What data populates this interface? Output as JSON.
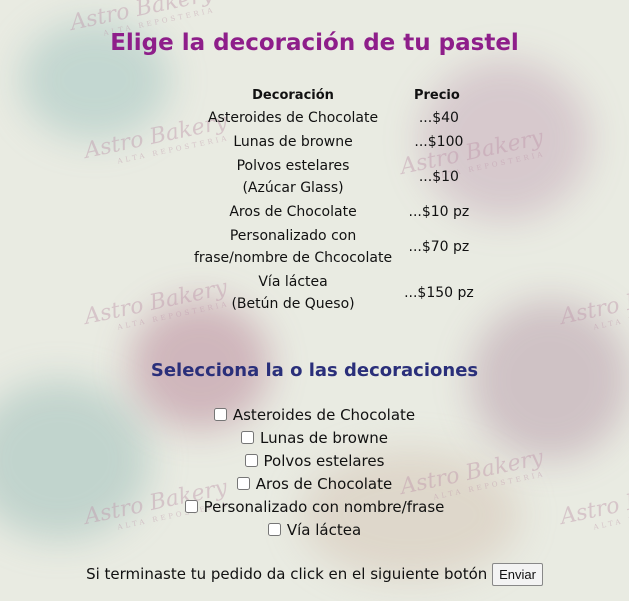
{
  "header": {
    "title": "Elige la decoración de tu pastel"
  },
  "table": {
    "headers": [
      "Decoración",
      "Precio"
    ],
    "rows": [
      {
        "name1": "Asteroides de Chocolate",
        "name2": "",
        "price": "...$40"
      },
      {
        "name1": "Lunas de browne",
        "name2": "",
        "price": "...$100"
      },
      {
        "name1": "Polvos estelares",
        "name2": "(Azúcar Glass)",
        "price": "...$10"
      },
      {
        "name1": "Aros de Chocolate",
        "name2": "",
        "price": "...$10 pz"
      },
      {
        "name1": "Personalizado con",
        "name2": "frase/nombre de Chcocolate",
        "price": "...$70 pz"
      },
      {
        "name1": "Vía láctea",
        "name2": "(Betún de Queso)",
        "price": "...$150 pz"
      }
    ]
  },
  "select_title": "Selecciona la o las decoraciones",
  "options": [
    "Asteroides de Chocolate",
    "Lunas de browne",
    "Polvos estelares",
    "Aros de Chocolate",
    "Personalizado con nombre/frase",
    "Vía láctea"
  ],
  "footer": {
    "text": "Si terminaste tu pedido da click en el siguiente botón",
    "button_label": "Enviar"
  },
  "watermark": {
    "brand": "Astro Bakery",
    "tagline": "ALTA REPOSTERIA"
  }
}
